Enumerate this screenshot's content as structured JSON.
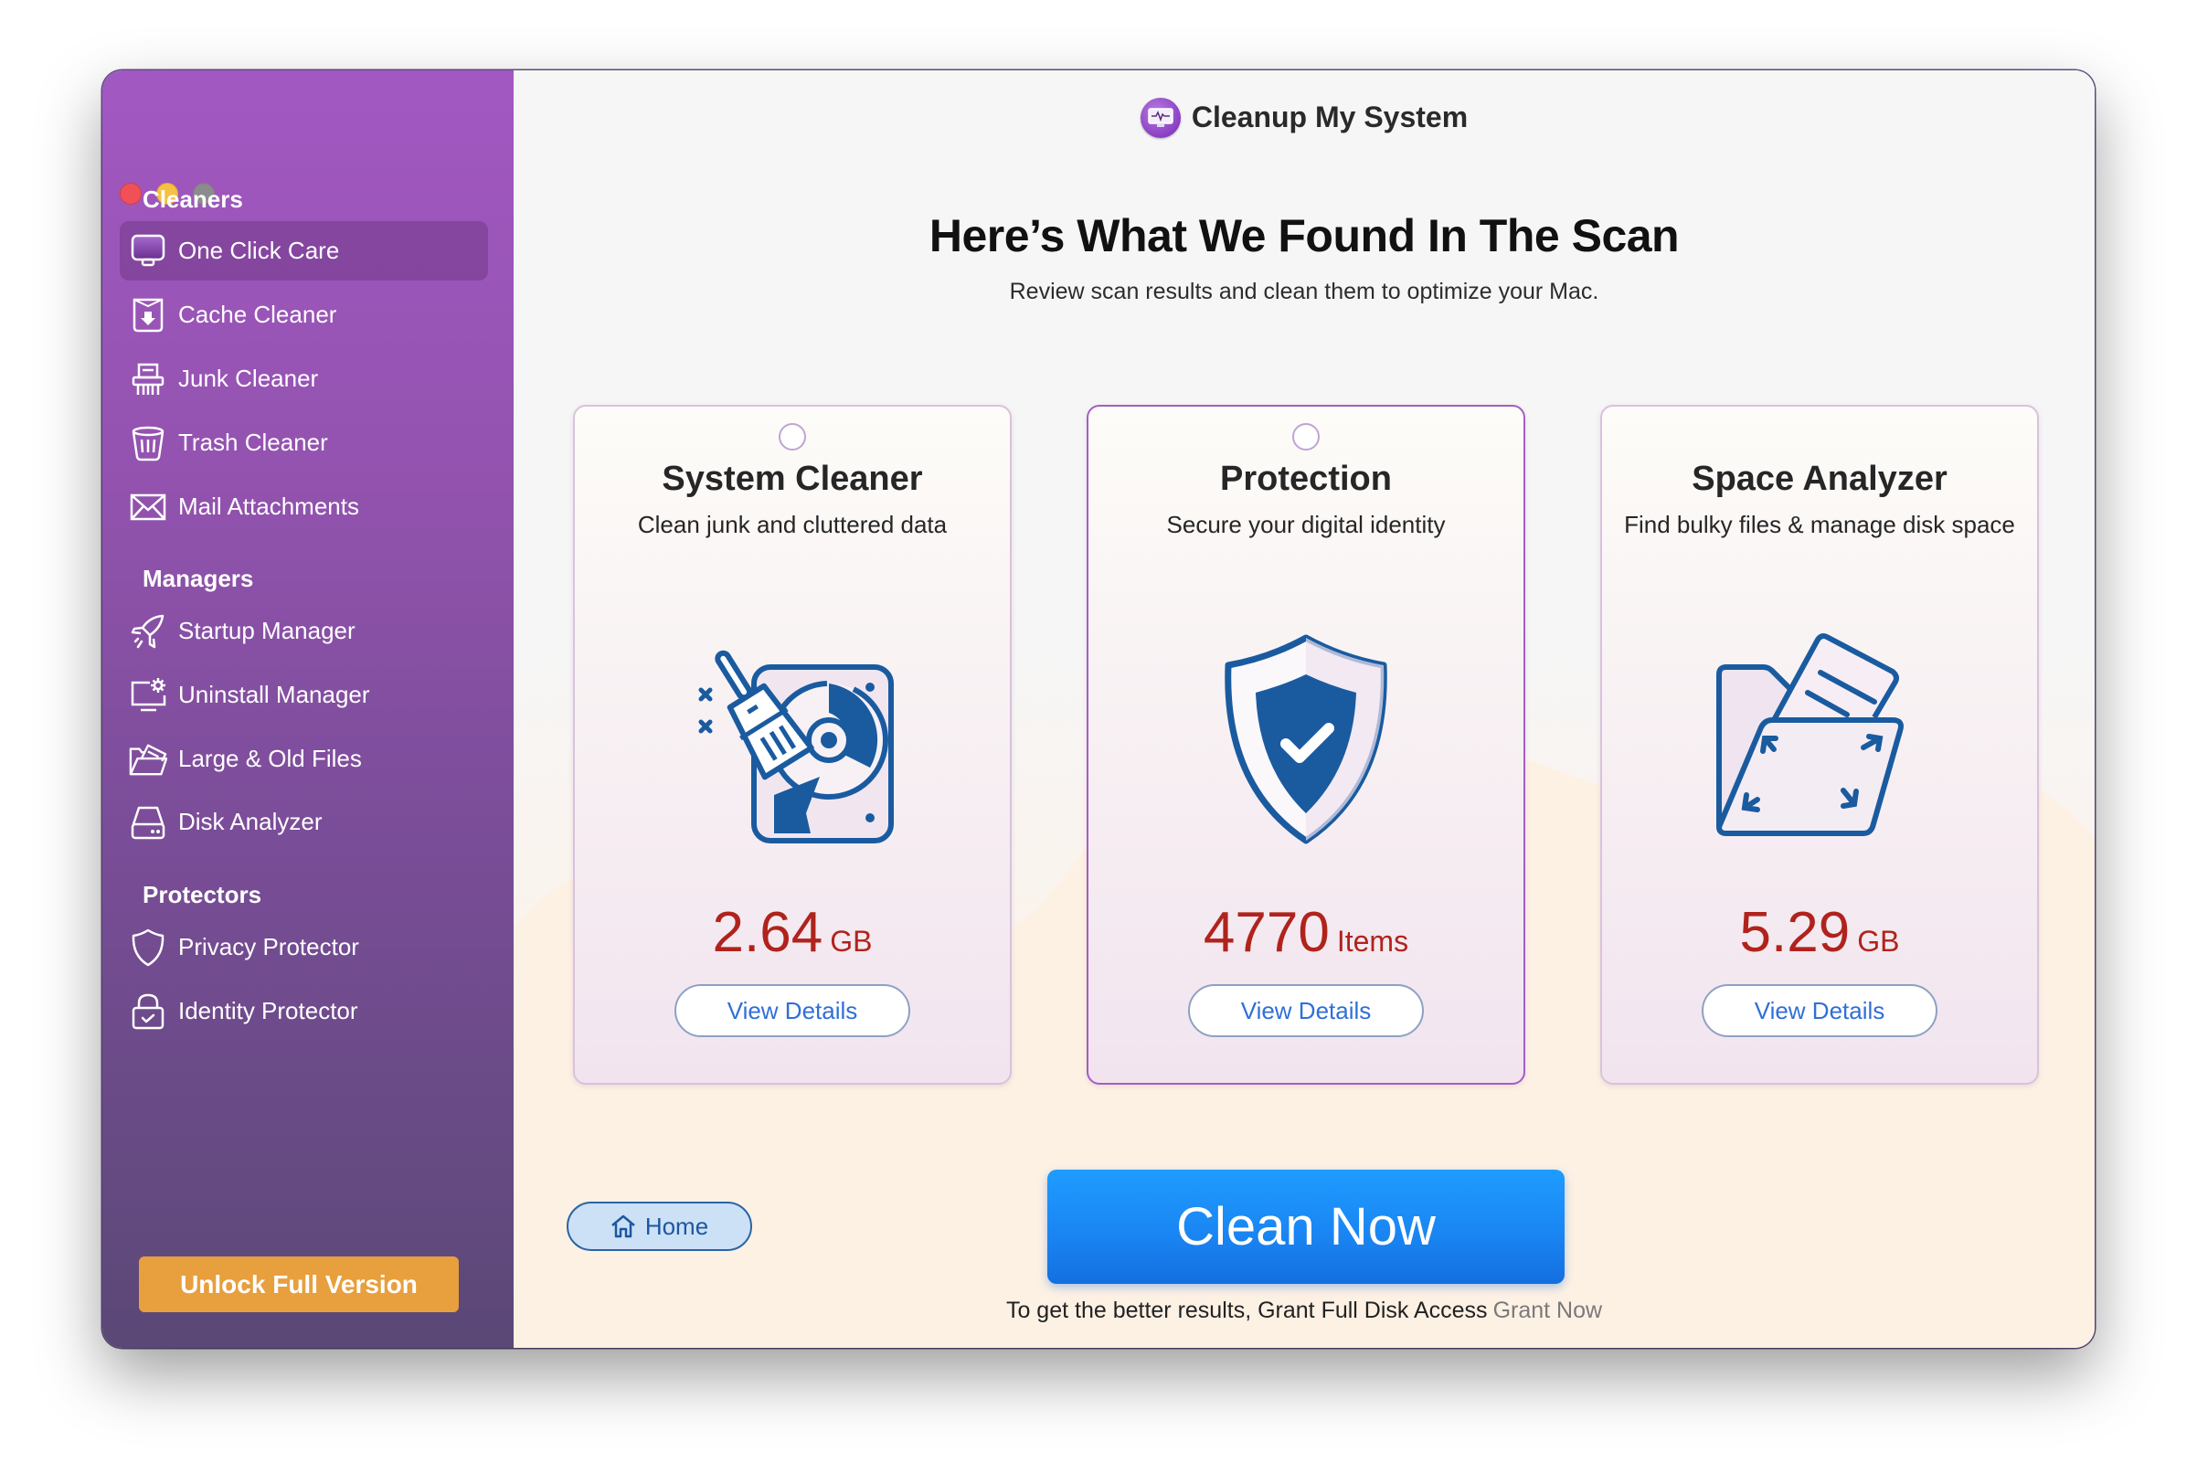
{
  "window": {
    "title": "Cleanup My System",
    "traffic_lights": [
      "close",
      "minimize",
      "zoom"
    ]
  },
  "sidebar": {
    "sections": [
      {
        "title": "Cleaners",
        "items": [
          {
            "label": "One Click Care",
            "icon": "monitor-icon",
            "active": true
          },
          {
            "label": "Cache Cleaner",
            "icon": "cache-download-icon",
            "active": false
          },
          {
            "label": "Junk Cleaner",
            "icon": "shredder-icon",
            "active": false
          },
          {
            "label": "Trash Cleaner",
            "icon": "trash-icon",
            "active": false
          },
          {
            "label": "Mail Attachments",
            "icon": "mail-icon",
            "active": false
          }
        ]
      },
      {
        "title": "Managers",
        "items": [
          {
            "label": "Startup Manager",
            "icon": "rocket-icon",
            "active": false
          },
          {
            "label": "Uninstall Manager",
            "icon": "monitor-gear-icon",
            "active": false
          },
          {
            "label": "Large & Old Files",
            "icon": "open-folder-icon",
            "active": false
          },
          {
            "label": "Disk Analyzer",
            "icon": "hard-drive-icon",
            "active": false
          }
        ]
      },
      {
        "title": "Protectors",
        "items": [
          {
            "label": "Privacy Protector",
            "icon": "shield-icon",
            "active": false
          },
          {
            "label": "Identity Protector",
            "icon": "lock-check-icon",
            "active": false
          }
        ]
      }
    ],
    "unlock_label": "Unlock Full Version"
  },
  "main": {
    "heading": "Here’s What We Found In The Scan",
    "subheading": "Review scan results and clean them to optimize your Mac.",
    "cards": [
      {
        "title": "System Cleaner",
        "description": "Clean junk and cluttered data",
        "value": "2.64",
        "unit": "GB",
        "button": "View Details",
        "icon": "disk-broom-icon",
        "has_radio": true,
        "selected": false
      },
      {
        "title": "Protection",
        "description": "Secure your digital identity",
        "value": "4770",
        "unit": "Items",
        "button": "View Details",
        "icon": "shield-check-icon",
        "has_radio": true,
        "selected": true
      },
      {
        "title": "Space Analyzer",
        "description": "Find bulky files & manage disk space",
        "value": "5.29",
        "unit": "GB",
        "button": "View Details",
        "icon": "folder-expand-icon",
        "has_radio": false,
        "selected": false
      }
    ],
    "home_label": "Home",
    "clean_now_label": "Clean Now",
    "footer_note": "To get the better results, Grant Full Disk Access",
    "grant_link": "Grant Now"
  },
  "colors": {
    "sidebar_top": "#a258c2",
    "sidebar_bottom": "#5a4876",
    "accent_orange": "#e89f3d",
    "value_red": "#b0231c",
    "link_blue": "#2f6fd8",
    "primary_blue": "#1a86f3",
    "icon_blue": "#1a5ba0"
  }
}
